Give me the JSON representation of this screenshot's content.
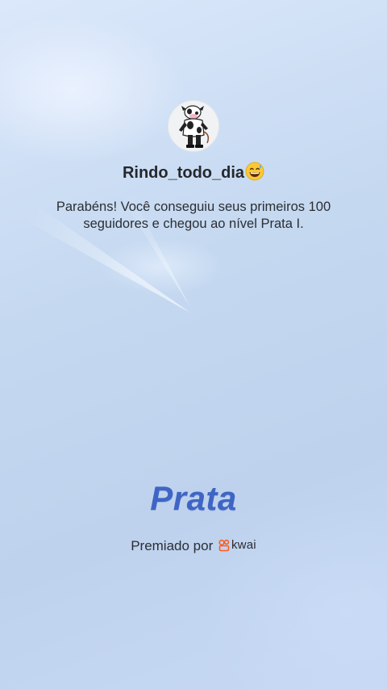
{
  "profile": {
    "username": "Rindo_todo_dia",
    "username_emoji": "grinning-sweat-emoji"
  },
  "message": "Parabéns! Você conseguiu seus primeiros 100 seguidores e chegou ao nível Prata I.",
  "level": {
    "name": "Prata",
    "color": "#3f65c4"
  },
  "footer": {
    "awarded_by": "Premiado por",
    "brand": "kwai",
    "brand_color": "#ff5a1f"
  }
}
